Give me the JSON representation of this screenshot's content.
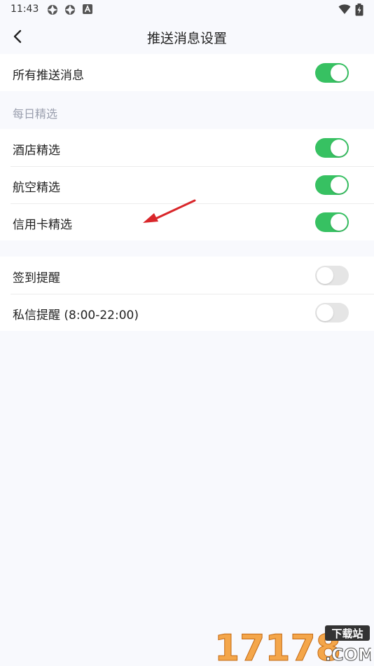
{
  "status_bar": {
    "time": "11:43",
    "icons": [
      "app-icon",
      "app-icon",
      "font-icon",
      "wifi-icon",
      "battery-icon"
    ]
  },
  "header": {
    "title": "推送消息设置",
    "back_icon": "chevron-left-icon"
  },
  "all_push": {
    "label": "所有推送消息",
    "enabled": true
  },
  "daily_picks": {
    "header": "每日精选",
    "items": [
      {
        "label": "酒店精选",
        "enabled": true
      },
      {
        "label": "航空精选",
        "enabled": true
      },
      {
        "label": "信用卡精选",
        "enabled": true
      }
    ]
  },
  "reminders": {
    "items": [
      {
        "label": "签到提醒",
        "enabled": false
      },
      {
        "label": "私信提醒 (8:00-22:00)",
        "enabled": false
      }
    ]
  },
  "watermark": {
    "number": "17178",
    "badge": "下载站",
    "domain": ".COM"
  },
  "colors": {
    "toggle_on": "#37c162",
    "toggle_off": "#e5e5e5",
    "background": "#f8f9fd",
    "annotation_arrow": "#d9262a"
  }
}
